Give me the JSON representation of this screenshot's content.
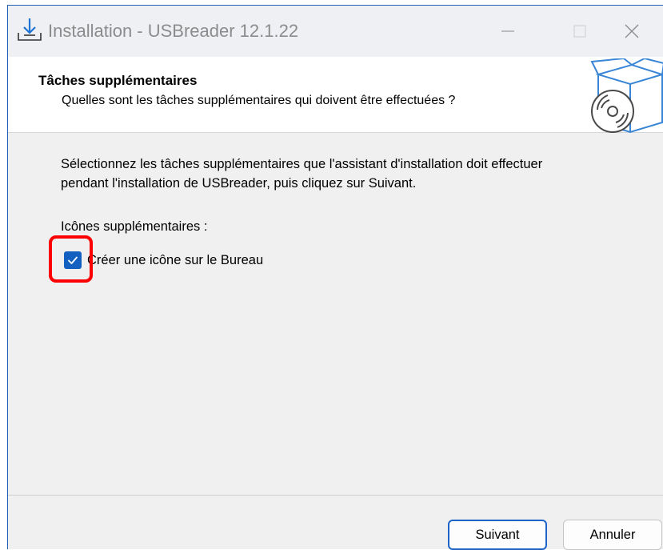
{
  "window": {
    "title": "Installation - USBreader 12.1.22"
  },
  "header": {
    "title": "Tâches supplémentaires",
    "subtitle": "Quelles sont les tâches supplémentaires qui doivent être effectuées ?",
    "icon": "software-box-cd-icon"
  },
  "main": {
    "description_line1": "Sélectionnez les tâches supplémentaires que l'assistant d'installation doit effectuer",
    "description_line2": "pendant l'installation de USBreader, puis cliquez sur Suivant.",
    "section_label": "Icônes supplémentaires :",
    "checkbox": {
      "label": "Créer une icône sur le Bureau",
      "checked": true
    }
  },
  "footer": {
    "next_label": "Suivant",
    "cancel_label": "Annuler"
  },
  "colors": {
    "accent": "#1360c1",
    "highlight": "#ff0000",
    "panel": "#f0f0f0"
  }
}
